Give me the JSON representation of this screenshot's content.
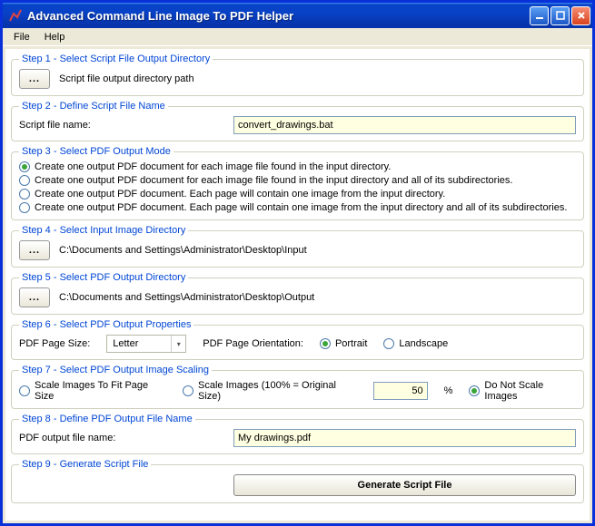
{
  "window": {
    "title": "Advanced Command Line Image To PDF Helper"
  },
  "menubar": {
    "file": "File",
    "help": "Help"
  },
  "step1": {
    "legend": "Step 1 - Select Script File Output Directory",
    "browse": "...",
    "path": "Script file output directory path"
  },
  "step2": {
    "legend": "Step 2 - Define Script File Name",
    "label": "Script file name:",
    "value": "convert_drawings.bat"
  },
  "step3": {
    "legend": "Step 3 - Select PDF Output Mode",
    "options": [
      "Create one output PDF document for each image file found in the input directory.",
      "Create one output PDF document for each image file found in the input directory and all of its subdirectories.",
      "Create one output PDF document. Each page will contain one image from the input directory.",
      "Create one output PDF document. Each page will contain one image from the input directory and all of its subdirectories."
    ],
    "selected": 0
  },
  "step4": {
    "legend": "Step 4 - Select Input Image Directory",
    "browse": "...",
    "path": "C:\\Documents and Settings\\Administrator\\Desktop\\Input"
  },
  "step5": {
    "legend": "Step 5 - Select PDF Output Directory",
    "browse": "...",
    "path": "C:\\Documents and Settings\\Administrator\\Desktop\\Output"
  },
  "step6": {
    "legend": "Step 6 - Select PDF Output Properties",
    "size_label": "PDF Page Size:",
    "size_value": "Letter",
    "orient_label": "PDF Page Orientation:",
    "portrait": "Portrait",
    "landscape": "Landscape",
    "orient_selected": "portrait"
  },
  "step7": {
    "legend": "Step 7 - Select PDF Output Image Scaling",
    "opt1": "Scale Images To Fit Page Size",
    "opt2": "Scale Images (100% = Original Size)",
    "percent": "50",
    "percent_suffix": "%",
    "opt3": "Do Not Scale Images",
    "selected": 2
  },
  "step8": {
    "legend": "Step 8 - Define PDF Output File Name",
    "label": "PDF output file name:",
    "value": "My drawings.pdf"
  },
  "step9": {
    "legend": "Step 9 - Generate Script File",
    "button": "Generate Script File"
  }
}
